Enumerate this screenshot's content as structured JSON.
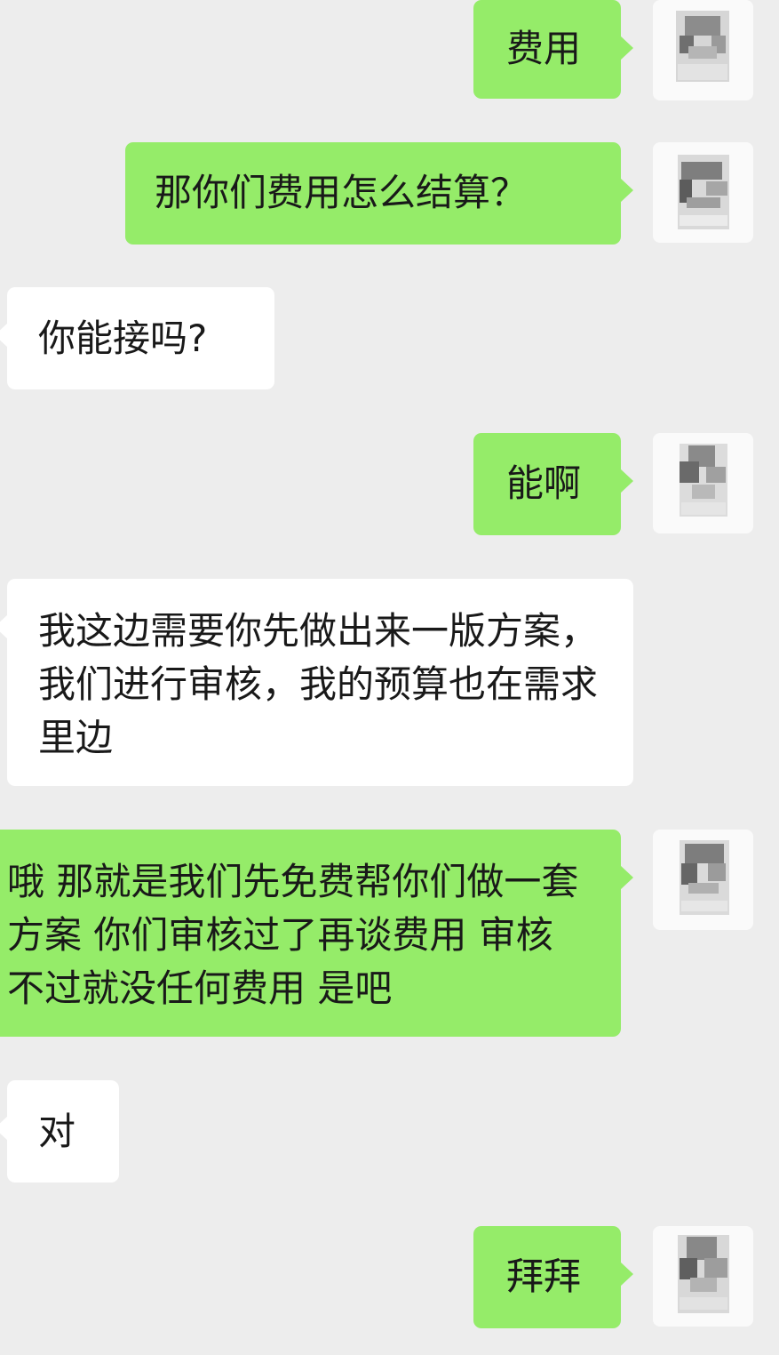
{
  "messages": [
    {
      "side": "out",
      "text": "费用",
      "avatar_icon": "pixelated-avatar-icon"
    },
    {
      "side": "out",
      "text": "那你们费用怎么结算？",
      "avatar_icon": "pixelated-avatar-icon"
    },
    {
      "side": "in",
      "text": "你能接吗?"
    },
    {
      "side": "out",
      "text": "能啊",
      "avatar_icon": "pixelated-avatar-icon"
    },
    {
      "side": "in",
      "text": "我这边需要你先做出来一版方案，我们进行审核，我的预算也在需求里边"
    },
    {
      "side": "out",
      "text": "哦 那就是我们先免费帮你们做一套方案 你们审核过了再谈费用 审核不过就没任何费用 是吧",
      "avatar_icon": "pixelated-avatar-icon"
    },
    {
      "side": "in",
      "text": "对"
    },
    {
      "side": "out",
      "text": "拜拜",
      "avatar_icon": "pixelated-avatar-icon"
    }
  ],
  "colors": {
    "background": "#ededed",
    "outgoing_bubble": "#95ec69",
    "incoming_bubble": "#ffffff",
    "text": "#191919"
  }
}
